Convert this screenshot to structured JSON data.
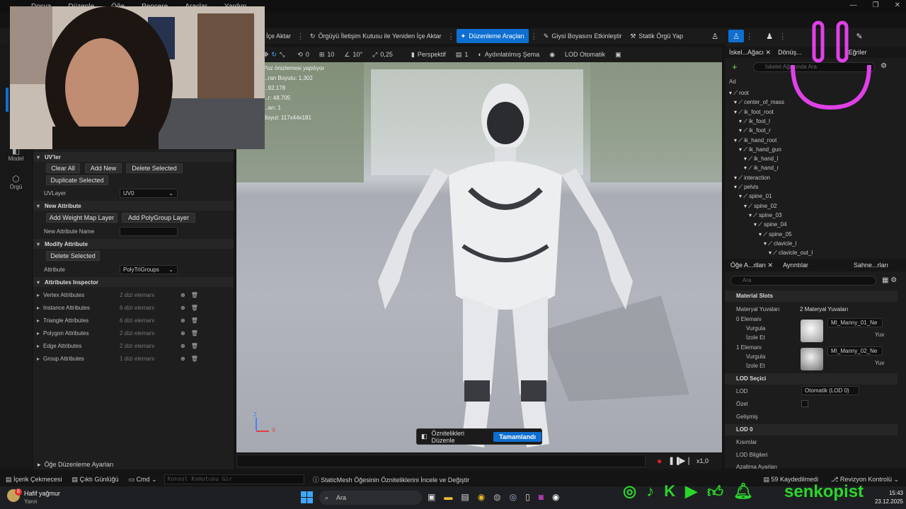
{
  "menubar": {
    "items": [
      "Dosya",
      "Düzenle",
      "Öğe",
      "Pencere",
      "Araçlar",
      "Yardım"
    ]
  },
  "toolbar": {
    "import": "İçe Aktar",
    "reimport": "Örgüyü İletişim Kutusu ile Yeniden İçe Aktar",
    "edit_tools": "Düzenleme Araçları",
    "paint": "Giysi Boyasını Etkinleştir",
    "static_mesh": "Statik Örgü Yap"
  },
  "lefttools": {
    "model": "Model",
    "mesh": "Örgü"
  },
  "uv": {
    "title": "UV'ler",
    "clear_all": "Clear All",
    "add_new": "Add New",
    "delete_selected": "Delete Selected",
    "duplicate_selected": "Duplicate Selected",
    "uvlayer_label": "UVLayer",
    "uvlayer_value": "UV0"
  },
  "new_attribute": {
    "title": "New Attribute",
    "add_weight_map": "Add Weight Map Layer",
    "add_polygroup": "Add PolyGroup Layer",
    "name_label": "New Attribute Name"
  },
  "modify_attribute": {
    "title": "Modify Attribute",
    "delete_selected": "Delete Selected",
    "attribute_label": "Attribute",
    "attribute_value": "PolyTriGroups"
  },
  "inspector": {
    "title": "Attributes Inspector",
    "rows": [
      {
        "name": "Vertex Attributes",
        "count": "2 dizi elemanı"
      },
      {
        "name": "Instance Attributes",
        "count": "6 dizi elemanı"
      },
      {
        "name": "Triangle Attributes",
        "count": "6 dizi elemanı"
      },
      {
        "name": "Polygon Attributes",
        "count": "2 dizi elemanı"
      },
      {
        "name": "Edge Attributes",
        "count": "2 dizi elemanı"
      },
      {
        "name": "Group Attributes",
        "count": "1 dizi elemanı"
      }
    ]
  },
  "edit_settings": "Öğe Düzenleme Ayarları",
  "viewport": {
    "move_val": "0",
    "grid_val": "10",
    "rot_val": "10°",
    "scale_val": "0,25",
    "perspective": "Perspektif",
    "count": "1",
    "lit": "Aydınlatılmış Şema",
    "lod": "LOD Otomatik",
    "stats": [
      "Poz önizlemesi yapılıyor",
      "...ran Boyutu: 1,302",
      "...92.178",
      "...r: 48.705",
      "...arı: 1",
      "Boyut: 117x44x181"
    ],
    "bottom_bar_text": "Öznitelikleri Düzenle",
    "done": "Tamamlandı",
    "axis_z": "Z",
    "axis_x": "X",
    "speed": "x1,0"
  },
  "skeleton_tabs": {
    "tree": "İskel...Ağacı",
    "transform": "Dönüş...",
    "curves": "Eğriler",
    "search_placeholder": "İskelet Ağacında Ara",
    "column": "Ad"
  },
  "bones": [
    {
      "name": "root",
      "indent": 0
    },
    {
      "name": "center_of_mass",
      "indent": 1
    },
    {
      "name": "ik_foot_root",
      "indent": 1
    },
    {
      "name": "ik_foot_l",
      "indent": 2
    },
    {
      "name": "ik_foot_r",
      "indent": 2
    },
    {
      "name": "ik_hand_root",
      "indent": 1
    },
    {
      "name": "ik_hand_gun",
      "indent": 2
    },
    {
      "name": "ik_hand_l",
      "indent": 3
    },
    {
      "name": "ik_hand_r",
      "indent": 3
    },
    {
      "name": "interaction",
      "indent": 1
    },
    {
      "name": "pelvis",
      "indent": 1
    },
    {
      "name": "spine_01",
      "indent": 2
    },
    {
      "name": "spine_02",
      "indent": 3
    },
    {
      "name": "spine_03",
      "indent": 4
    },
    {
      "name": "spine_04",
      "indent": 5
    },
    {
      "name": "spine_05",
      "indent": 6
    },
    {
      "name": "clavicle_l",
      "indent": 7
    },
    {
      "name": "clavicle_out_l",
      "indent": 8
    }
  ],
  "details_tabs": {
    "asset": "Öğe A...ıtları",
    "details": "Ayrıntılar",
    "scene": "Sahne...rları",
    "search_placeholder": "Ara"
  },
  "material": {
    "title": "Material Slots",
    "slots_label": "Materyal Yuvaları",
    "slots_value": "2 Materyal Yuvaları",
    "elem0": "0 Elemanı",
    "elem1": "1 Elemanı",
    "highlight": "Vurgula",
    "isolate": "İzole Et",
    "mat0": "MI_Manny_01_Ne",
    "mat1": "MI_Manny_02_Ne",
    "slot_suffix": "Yuv"
  },
  "lod_picker": {
    "title": "LOD Seçici",
    "lod_label": "LOD",
    "lod_value": "Otomatik (LOD 0)",
    "custom_label": "Özel",
    "advanced": "Gelişmiş"
  },
  "lod0": {
    "title": "LOD 0",
    "sections": "Kısımlar",
    "info": "LOD Bilgileri",
    "reduction": "Azaltma Ayarları"
  },
  "statusbar": {
    "content": "İçerik Çekmecesi",
    "output": "Çıktı Günlüğü",
    "cmd": "Cmd",
    "console_placeholder": "Konsol Komutunu Gir",
    "hint": "StaticMesh Öğesinin Özniteliklerini İncele ve Değiştir",
    "saved": "59 Kaydedilmedi",
    "revision": "Revizyon Kontrolü"
  },
  "taskbar": {
    "weather_title": "Hafif yağmur",
    "weather_sub": "Yarın",
    "weather_badge": "8",
    "search": "Ara",
    "time": "15:43",
    "date": "23.12.2025"
  },
  "overlay": {
    "handle": "senkopist"
  },
  "colors": {
    "accent": "#0f6fd1",
    "overlay_green": "#2bd62b",
    "smile": "#e040e8"
  }
}
